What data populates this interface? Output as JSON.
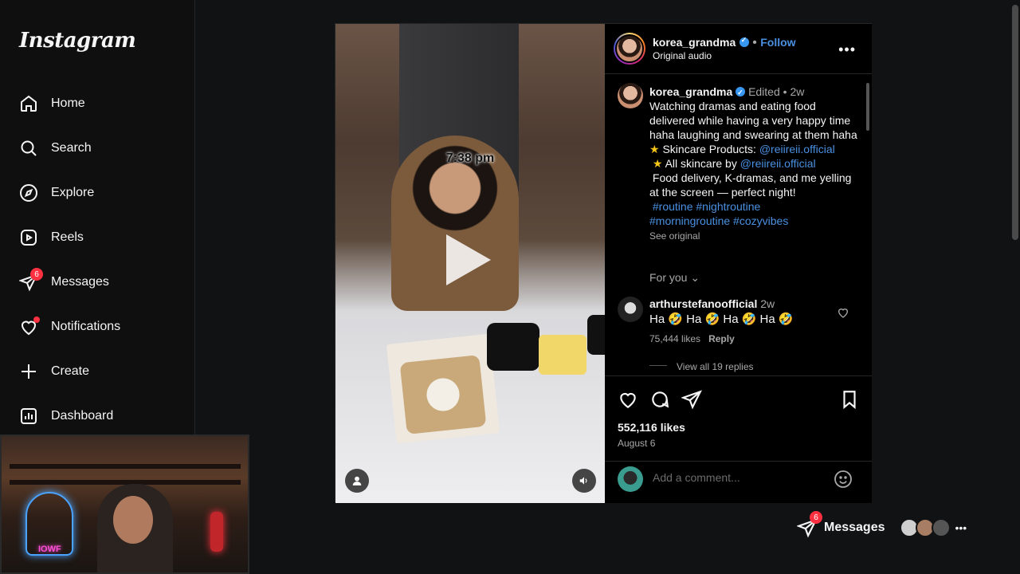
{
  "app": {
    "logo": "Instagram"
  },
  "sidebar": {
    "items": [
      {
        "label": "Home"
      },
      {
        "label": "Search"
      },
      {
        "label": "Explore"
      },
      {
        "label": "Reels"
      },
      {
        "label": "Messages",
        "badge": "6"
      },
      {
        "label": "Notifications"
      },
      {
        "label": "Create"
      },
      {
        "label": "Dashboard"
      }
    ]
  },
  "webcam": {
    "neon_text": "IOWF"
  },
  "post": {
    "video": {
      "overlay_time": "7:38 pm"
    },
    "header": {
      "username": "korea_grandma",
      "separator": "•",
      "follow_label": "Follow",
      "audio": "Original audio"
    },
    "caption": {
      "username": "korea_grandma",
      "edited": "Edited",
      "age": "2w",
      "text_main": "Watching dramas and eating food delivered while having a very happy time haha laughing and swearing at them haha",
      "line_skincare_prefix": "Skincare Products: ",
      "line_skincare_handle": "@reiireii.official",
      "line_all_prefix": "All skincare by ",
      "line_all_handle": "@reiireii.official",
      "line_food": "Food delivery, K-dramas, and me yelling at the screen — perfect night!",
      "hashtags_1": "#routine #nightroutine",
      "hashtags_2": "#morningroutine #cozyvibes",
      "see_original": "See original",
      "star": "★"
    },
    "for_you_label": "For you",
    "top_comment": {
      "username": "arthurstefanoofficial",
      "age": "2w",
      "text": "Ha 🤣 Ha 🤣 Ha 🤣 Ha 🤣",
      "likes": "75,444 likes",
      "reply_label": "Reply",
      "view_replies": "View all 19 replies"
    },
    "likes_count": "552,116 likes",
    "date": "August 6",
    "comment_placeholder": "Add a comment..."
  },
  "messages_bar": {
    "label": "Messages",
    "badge": "6"
  },
  "colors": {
    "accent": "#4a90e2",
    "badge": "#ff3040",
    "bg": "#111214"
  }
}
